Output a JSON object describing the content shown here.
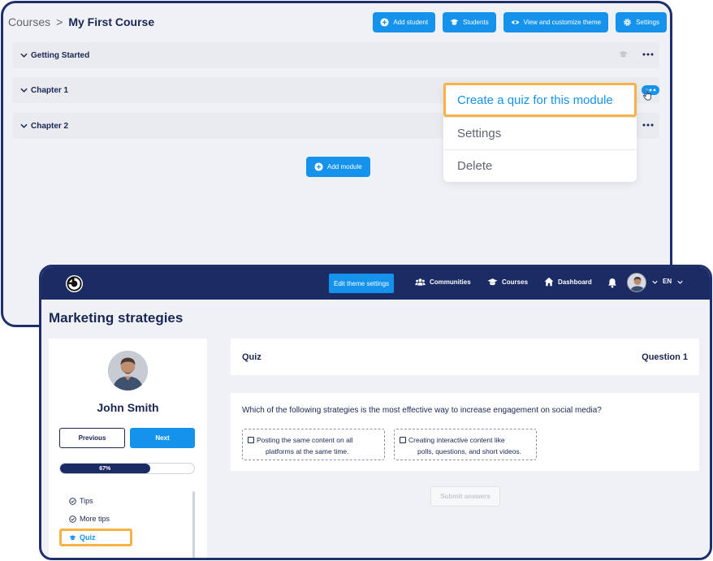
{
  "course_builder": {
    "breadcrumb": {
      "root": "Courses",
      "separator": ">",
      "current": "My First Course"
    },
    "actions": [
      {
        "label": "Add student",
        "icon": "plus-circle-icon"
      },
      {
        "label": "Students",
        "icon": "graduation-cap-icon"
      },
      {
        "label": "View and customize theme",
        "icon": "eye-icon"
      },
      {
        "label": "Settings",
        "icon": "gear-icon"
      }
    ],
    "modules": [
      {
        "title": "Getting Started"
      },
      {
        "title": "Chapter 1"
      },
      {
        "title": "Chapter 2"
      }
    ],
    "add_module_label": "Add module",
    "module_menu": [
      {
        "label": "Create a quiz for this module"
      },
      {
        "label": "Settings"
      },
      {
        "label": "Delete"
      }
    ]
  },
  "student_view": {
    "nav": {
      "logo_icon": "brand-logo-icon",
      "edit_theme_label": "Edit theme settings",
      "links": [
        {
          "label": "Communities",
          "icon": "users-icon"
        },
        {
          "label": "Courses",
          "icon": "graduation-cap-icon"
        },
        {
          "label": "Dashboard",
          "icon": "home-icon"
        }
      ],
      "language": "EN"
    },
    "page_title": "Marketing strategies",
    "sidebar": {
      "student_name": "John Smith",
      "previous_label": "Previous",
      "next_label": "Next",
      "progress_label": "67%",
      "progress_value": 0.67,
      "lessons": [
        {
          "label": "Tips",
          "icon": "check-circle-icon"
        },
        {
          "label": "More tips",
          "icon": "check-circle-icon"
        },
        {
          "label": "Quiz",
          "icon": "graduation-cap-icon"
        }
      ]
    },
    "quiz": {
      "title": "Quiz",
      "question_number": "Question 1",
      "question": "Which of the following strategies is the most effective way to increase engagement on social media?",
      "options": [
        {
          "line1": "Posting the same content on all",
          "line2": "platforms at the same time."
        },
        {
          "line1": "Creating interactive content like",
          "line2": "polls, questions, and short videos."
        }
      ],
      "submit_label": "Submit answers"
    }
  },
  "colors": {
    "navy": "#1b2b64",
    "accent_blue": "#1593ec",
    "highlight_orange": "#f5b247",
    "panel_bg": "#f0f1f5"
  }
}
